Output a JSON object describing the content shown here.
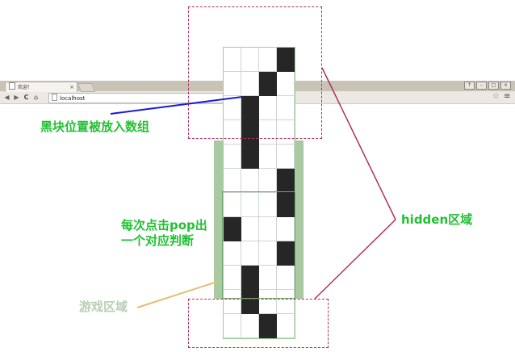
{
  "browser": {
    "tab_title": "欢迎！",
    "tab_close": "×",
    "address": "localhost",
    "window_controls": [
      "↑",
      "–",
      "□",
      "×"
    ],
    "nav_icons": [
      "back-icon",
      "forward-icon",
      "reload-icon",
      "home-icon"
    ],
    "nav_glyphs": [
      "◀",
      "▶",
      "C",
      "⌂"
    ],
    "star_glyph": "☆",
    "menu_glyph": "≡"
  },
  "game": {
    "columns": 4,
    "rows": 12,
    "black_cells": [
      [
        0,
        3
      ],
      [
        1,
        2
      ],
      [
        2,
        1
      ],
      [
        3,
        1
      ],
      [
        4,
        1
      ],
      [
        5,
        3
      ],
      [
        6,
        3
      ],
      [
        7,
        0
      ],
      [
        8,
        3
      ],
      [
        9,
        1
      ],
      [
        10,
        1
      ],
      [
        11,
        2
      ]
    ]
  },
  "annotations": {
    "black_positions": "黑块位置被放入数组",
    "pop_line1": "每次点击pop出",
    "pop_line2": "一个对应判断",
    "game_area": "游戏区域",
    "hidden_area": "hidden区域"
  },
  "colors": {
    "annotation_green": "#22c033",
    "game_area_label": "#b8ceb4",
    "hidden_border": "#b03060",
    "arrow_blue": "#1a1ad8",
    "arrow_tan": "#e0c070",
    "game_bg": "#a9c9a2",
    "black_tile": "#262626"
  }
}
